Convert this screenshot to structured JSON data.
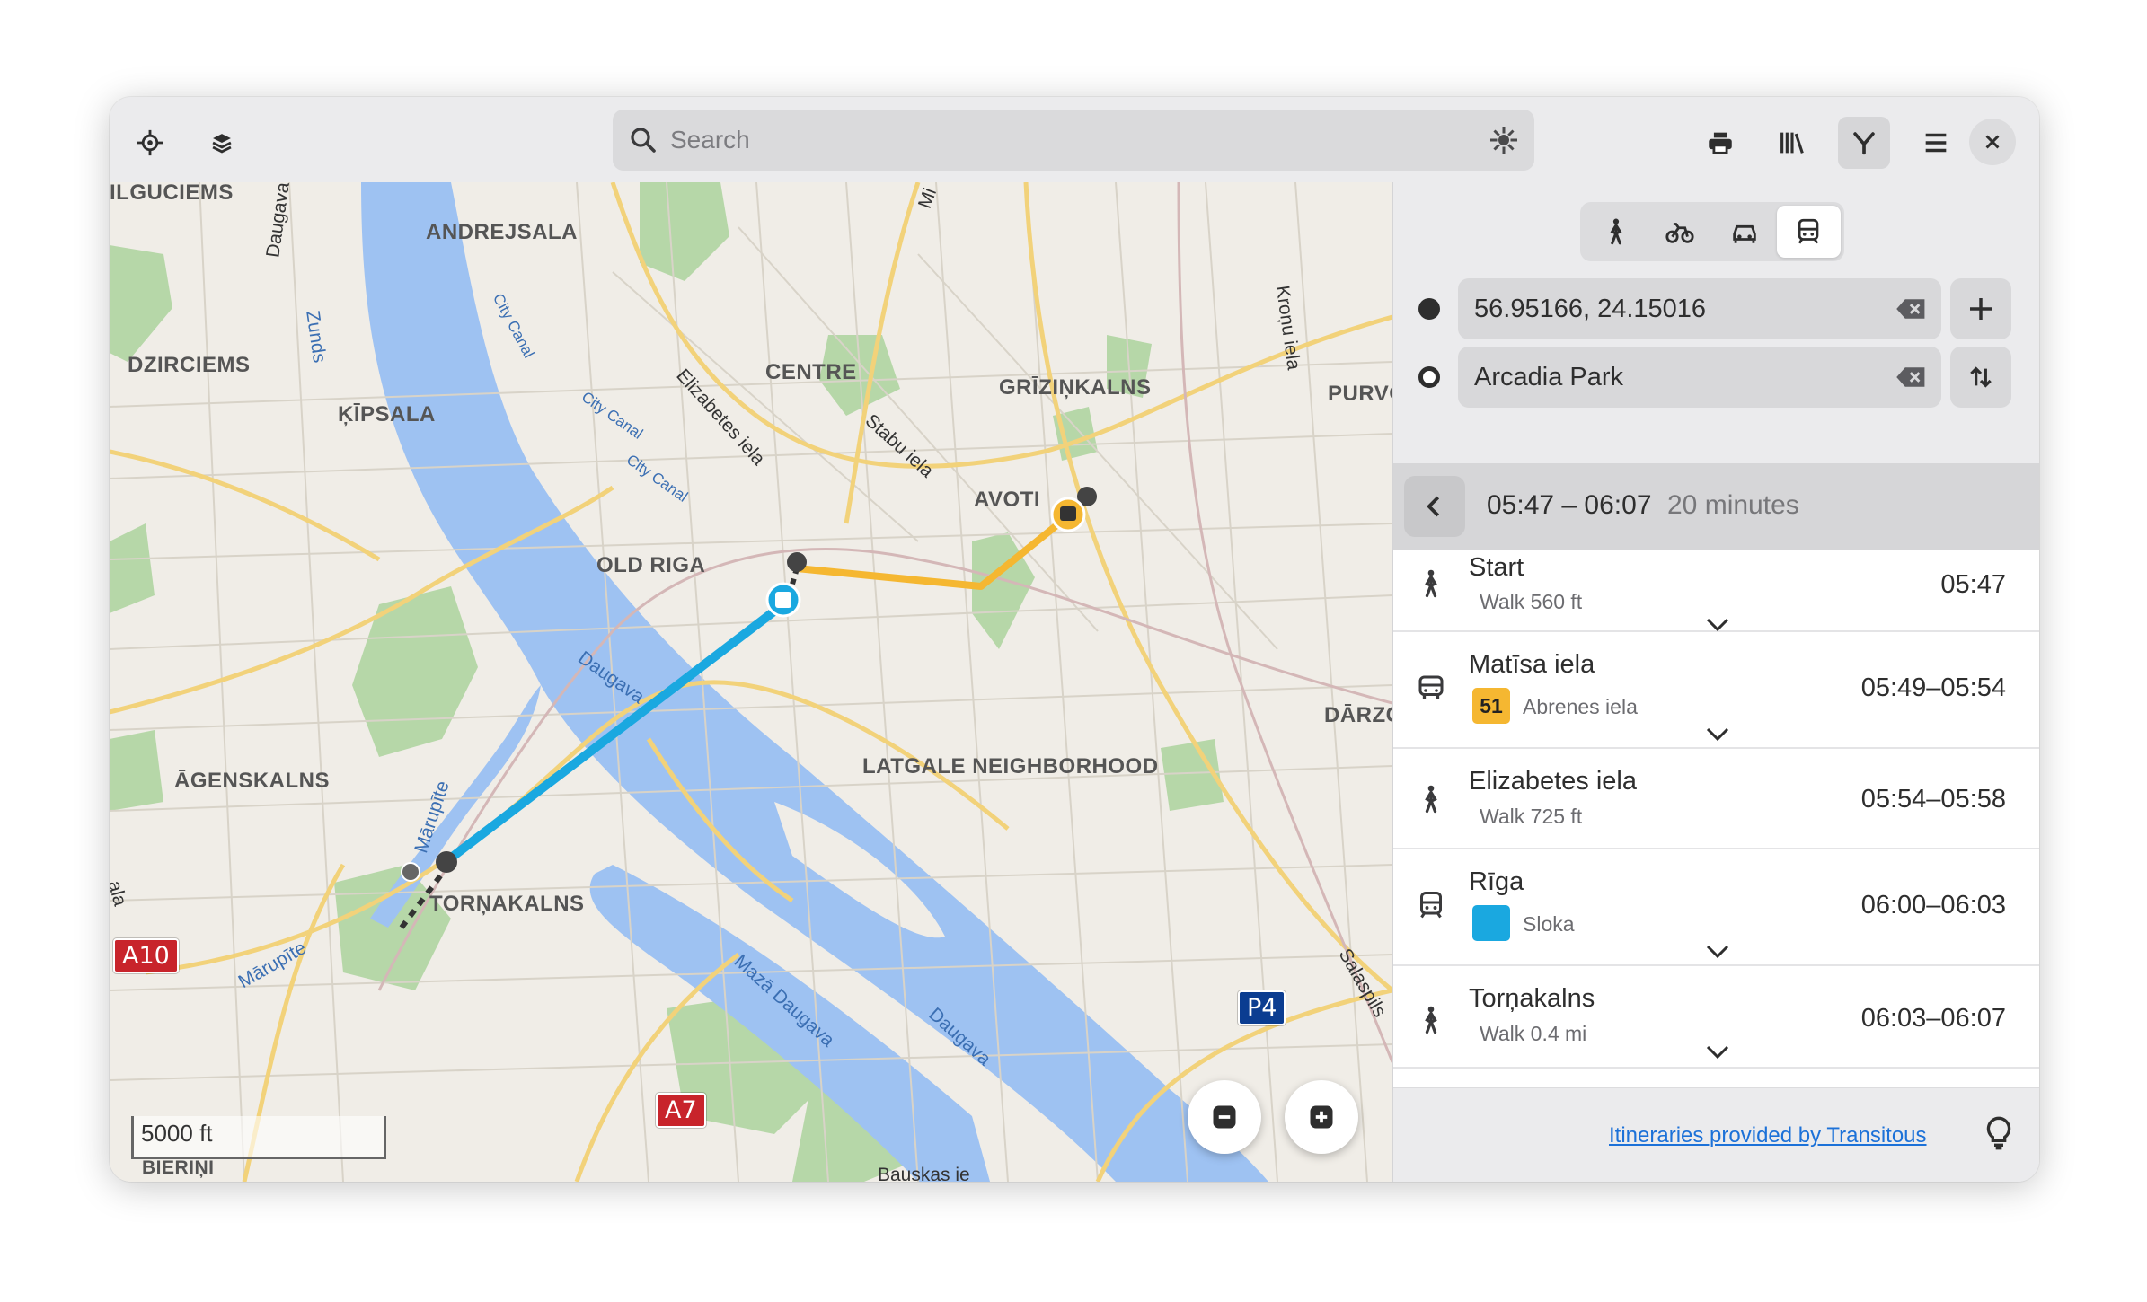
{
  "header": {
    "search_placeholder": "Search",
    "icons": [
      "locate-icon",
      "layers-icon",
      "print-icon",
      "library-icon",
      "route-icon",
      "menu-icon",
      "close-icon"
    ]
  },
  "map": {
    "labels": {
      "ilguciems": "ILGUCIEMS",
      "andrejsala": "ANDREJSALA",
      "dzirciems": "DZIRCIEMS",
      "kipsala": "ĶĪPSALA",
      "centre": "CENTRE",
      "grizinkalns": "GRĪZIŅKALNS",
      "purvc": "PURVC",
      "avoti": "AVOTI",
      "old_riga": "OLD RIGA",
      "darzc": "DĀRZC",
      "agenskalns": "ĀGENSKALNS",
      "latgale": "LATGALE NEIGHBORHOOD",
      "tornakalns": "TORŅAKALNS",
      "bierini": "BIERIŅI"
    },
    "road_labels": {
      "daugava1": "Daugava",
      "zunds": "Zunds",
      "city_canal1": "City Canal",
      "city_canal2": "City Canal",
      "city_canal3": "City Canal",
      "elizabetes": "Elizabetes iela",
      "stabu": "Stabu iela",
      "kronu": "Kroņu iela",
      "daugava2": "Daugava",
      "daugava3": "Daugava",
      "maza_daugava": "Mazā Daugava",
      "marupite1": "Mārupīte",
      "marupite2": "Mārupīte",
      "salaspils": "Salaspils",
      "ala": "ala",
      "mi": "Mi",
      "bauskas": "Bauskas ie"
    },
    "shields": {
      "a10": "A10",
      "a7": "A7",
      "p4": "P4"
    },
    "scale": "5000 ft",
    "colors": {
      "water": "#9ec2f2",
      "park": "#b6d7a8",
      "bus_route": "#f5b731",
      "train_route": "#1aa8e0"
    }
  },
  "sidebar": {
    "modes": [
      "walk-icon",
      "bike-icon",
      "car-icon",
      "transit-icon"
    ],
    "active_mode": "transit",
    "origin": "56.95166, 24.15016",
    "destination": "Arcadia Park",
    "itinerary": {
      "time_range": "05:47 – 06:07",
      "duration": "20 minutes"
    },
    "legs": [
      {
        "title": "Start",
        "subtitle": "Walk 560 ft",
        "time": "05:47"
      },
      {
        "title": "Matīsa iela",
        "route_badge": "51",
        "route_color": "#f5b731",
        "route_name": "Abrenes iela",
        "time": "05:49–05:54"
      },
      {
        "title": "Elizabetes iela",
        "subtitle": "Walk 725 ft",
        "time": "05:54–05:58"
      },
      {
        "title": "Rīga",
        "route_badge": "",
        "route_color": "#1aa8e0",
        "route_name": "Sloka",
        "time": "06:00–06:03"
      },
      {
        "title": "Torņakalns",
        "subtitle": "Walk 0.4 mi",
        "time": "06:03–06:07"
      }
    ],
    "footer_link": "Itineraries provided by Transitous"
  }
}
